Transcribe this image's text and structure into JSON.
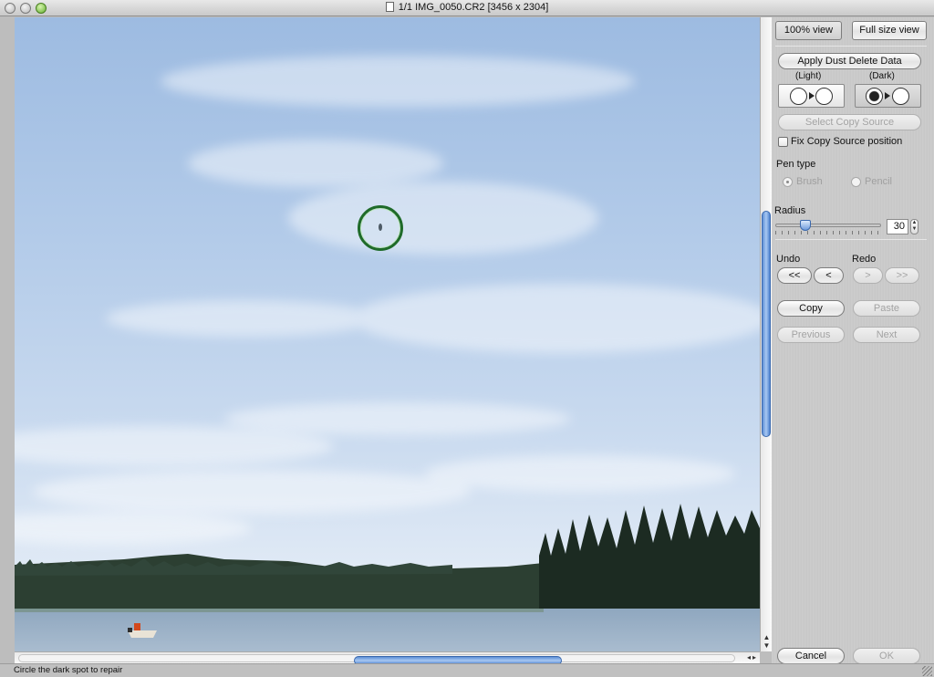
{
  "window": {
    "title": "1/1 IMG_0050.CR2 [3456 x 2304]",
    "status": "Circle the dark spot to repair"
  },
  "view_buttons": {
    "view_100": "100% view",
    "full_size": "Full size view"
  },
  "panel": {
    "apply_label": "Apply Dust Delete Data",
    "light_label": "(Light)",
    "dark_label": "(Dark)",
    "select_copy_source": "Select Copy Source",
    "fix_copy_source": "Fix Copy Source position",
    "fix_copy_source_checked": false,
    "pen_type_label": "Pen type",
    "pen_brush": "Brush",
    "pen_pencil": "Pencil",
    "pen_selected": "Brush",
    "radius_label": "Radius",
    "radius_value": "30",
    "undo_label": "Undo",
    "redo_label": "Redo",
    "undo_all": "<<",
    "undo_one": "<",
    "redo_one": ">",
    "redo_all": ">>",
    "copy": "Copy",
    "paste": "Paste",
    "previous": "Previous",
    "next": "Next",
    "cancel": "Cancel",
    "ok": "OK"
  },
  "colors": {
    "scroll_thumb": "#5d8fd6",
    "spot_ring": "#1f6b2a"
  },
  "icons": {
    "light_mode": "open-circle-arrow-circle-icon",
    "dark_mode": "filled-circle-arrow-circle-icon",
    "document": "document-icon"
  }
}
